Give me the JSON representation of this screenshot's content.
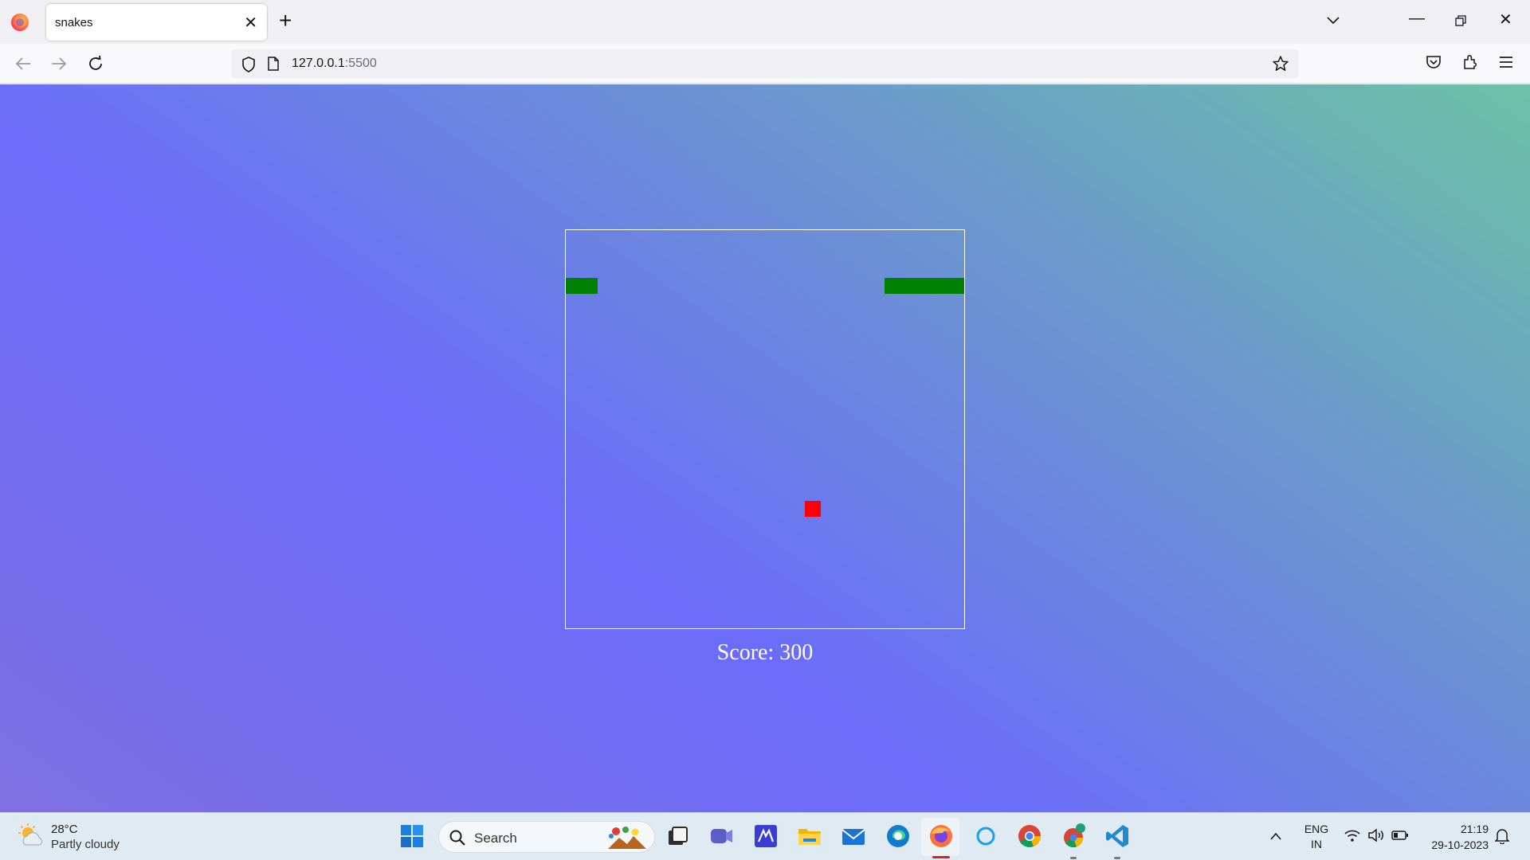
{
  "browser": {
    "tab_title": "snakes",
    "url_host": "127.0.0.1",
    "url_port": ":5500"
  },
  "game": {
    "score_label": "Score: 300",
    "snake_segments": [
      {
        "col": 0,
        "row": 3
      },
      {
        "col": 1,
        "row": 3
      },
      {
        "col": 20,
        "row": 3
      },
      {
        "col": 21,
        "row": 3
      },
      {
        "col": 22,
        "row": 3
      },
      {
        "col": 23,
        "row": 3
      },
      {
        "col": 24,
        "row": 3
      }
    ],
    "food": {
      "col": 15,
      "row": 17
    },
    "grid": {
      "cols": 25,
      "rows": 25
    },
    "colors": {
      "snake": "#008000",
      "food": "#ff0000",
      "border": "#ffffff"
    }
  },
  "taskbar": {
    "weather_temp": "28°C",
    "weather_desc": "Partly cloudy",
    "search_label": "Search",
    "lang_line1": "ENG",
    "lang_line2": "IN",
    "time": "21:19",
    "date": "29-10-2023"
  }
}
